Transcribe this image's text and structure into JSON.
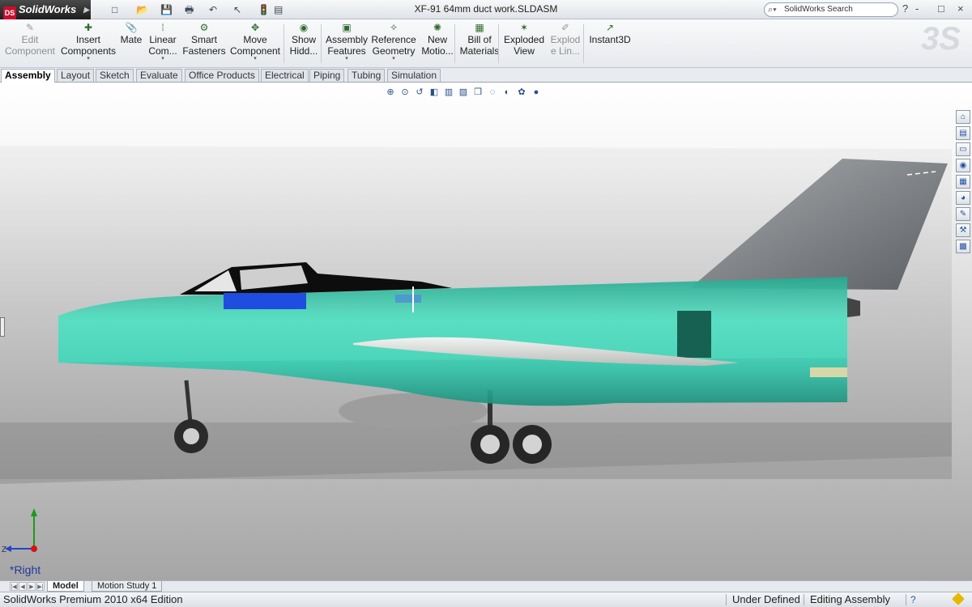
{
  "app": {
    "name": "SolidWorks",
    "logo_glyph": "DS",
    "document_title": "XF-91 64mm duct work.SLDASM",
    "search_placeholder": "SolidWorks Search",
    "window_controls": [
      "?",
      "-",
      "□",
      "×"
    ]
  },
  "quick_access": [
    {
      "icon": "new-document-icon",
      "glyph": "□"
    },
    {
      "icon": "open-folder-icon",
      "glyph": "📂"
    },
    {
      "icon": "save-icon",
      "glyph": "💾"
    },
    {
      "icon": "print-icon",
      "glyph": "🖶"
    },
    {
      "icon": "undo-icon",
      "glyph": "↶"
    },
    {
      "icon": "select-arrow-icon",
      "glyph": "↖"
    },
    {
      "icon": "rebuild-icon",
      "glyph": "🚦"
    },
    {
      "icon": "options-icon",
      "glyph": "▤"
    }
  ],
  "command_manager": [
    {
      "id": "edit-component",
      "label": "Edit Component",
      "icon": "edit-component-icon",
      "glyph": "✎",
      "disabled": true
    },
    {
      "id": "insert-components",
      "label": "Insert Components",
      "icon": "insert-components-icon",
      "glyph": "✚",
      "disabled": false,
      "dropdown": true
    },
    {
      "id": "mate",
      "label": "Mate",
      "icon": "mate-icon",
      "glyph": "📎",
      "disabled": false
    },
    {
      "id": "linear-component-pattern",
      "label": "Linear Com...",
      "icon": "linear-pattern-icon",
      "glyph": "⁞",
      "disabled": false,
      "dropdown": true
    },
    {
      "id": "smart-fasteners",
      "label": "Smart Fasteners",
      "icon": "smart-fasteners-icon",
      "glyph": "⚙",
      "disabled": false
    },
    {
      "id": "move-component",
      "label": "Move Component",
      "icon": "move-component-icon",
      "glyph": "✥",
      "disabled": false,
      "dropdown": true
    },
    {
      "id": "show-hidden",
      "label": "Show Hidd...",
      "icon": "show-hidden-icon",
      "glyph": "◉",
      "disabled": false
    },
    {
      "id": "assembly-features",
      "label": "Assembly Features",
      "icon": "assembly-features-icon",
      "glyph": "▣",
      "disabled": false,
      "dropdown": true
    },
    {
      "id": "reference-geometry",
      "label": "Reference Geometry",
      "icon": "reference-geometry-icon",
      "glyph": "✧",
      "disabled": false,
      "dropdown": true
    },
    {
      "id": "new-motion-study",
      "label": "New Motio...",
      "icon": "new-motion-study-icon",
      "glyph": "✺",
      "disabled": false
    },
    {
      "id": "bill-of-materials",
      "label": "Bill of Materials",
      "icon": "bill-of-materials-icon",
      "glyph": "▦",
      "disabled": false
    },
    {
      "id": "exploded-view",
      "label": "Exploded View",
      "icon": "exploded-view-icon",
      "glyph": "✶",
      "disabled": false
    },
    {
      "id": "explode-line-sketch",
      "label": "Explod e Lin...",
      "icon": "explode-line-icon",
      "glyph": "✐",
      "disabled": true
    },
    {
      "id": "instant3d",
      "label": "Instant3D",
      "icon": "instant3d-icon",
      "glyph": "↗",
      "disabled": false
    }
  ],
  "tabs": [
    "Assembly",
    "Layout",
    "Sketch",
    "Evaluate",
    "Office Products",
    "Electrical",
    "Piping",
    "Tubing",
    "Simulation"
  ],
  "active_tab": "Assembly",
  "heads_up_toolbar": [
    {
      "icon": "zoom-to-fit-icon",
      "glyph": "⊕"
    },
    {
      "icon": "zoom-to-area-icon",
      "glyph": "⊙"
    },
    {
      "icon": "previous-view-icon",
      "glyph": "↺"
    },
    {
      "icon": "section-view-icon",
      "glyph": "◧"
    },
    {
      "icon": "dynamic-annotation-icon",
      "glyph": "▥"
    },
    {
      "icon": "view-orientation-icon",
      "glyph": "▨"
    },
    {
      "icon": "display-style-icon",
      "glyph": "❒"
    },
    {
      "icon": "hide-show-items-icon",
      "glyph": "◌"
    },
    {
      "icon": "edit-appearance-icon",
      "glyph": "◐"
    },
    {
      "icon": "apply-scene-icon",
      "glyph": "✿"
    },
    {
      "icon": "view-settings-icon",
      "glyph": "●"
    }
  ],
  "task_pane": [
    {
      "icon": "solidworks-resources-icon",
      "glyph": "⌂"
    },
    {
      "icon": "design-library-icon",
      "glyph": "▤"
    },
    {
      "icon": "file-explorer-icon",
      "glyph": "▭"
    },
    {
      "icon": "search-results-icon",
      "glyph": "◉"
    },
    {
      "icon": "view-palette-icon",
      "glyph": "▦"
    },
    {
      "icon": "appearances-icon",
      "glyph": "◕"
    },
    {
      "icon": "custom-properties-icon",
      "glyph": "✎"
    },
    {
      "icon": "toolbox-icon",
      "glyph": "⚒"
    },
    {
      "icon": "document-recovery-icon",
      "glyph": "▩"
    }
  ],
  "viewport": {
    "view_label": "*Right",
    "controls": [
      "-",
      "⧉",
      "×"
    ],
    "colors": {
      "fuselage": "#36c7ad",
      "canopy_frame": "#0d0d0d",
      "wing": "#dcdedb",
      "tail": "#6b6f73",
      "panel": "#1e4ee0",
      "band": "#166152"
    }
  },
  "bottom_tabs": [
    "Model",
    "Motion Study 1"
  ],
  "active_bottom_tab": "Model",
  "status_bar": {
    "edition": "SolidWorks Premium 2010 x64 Edition",
    "definition": "Under Defined",
    "mode": "Editing Assembly",
    "help_glyph": "?"
  }
}
